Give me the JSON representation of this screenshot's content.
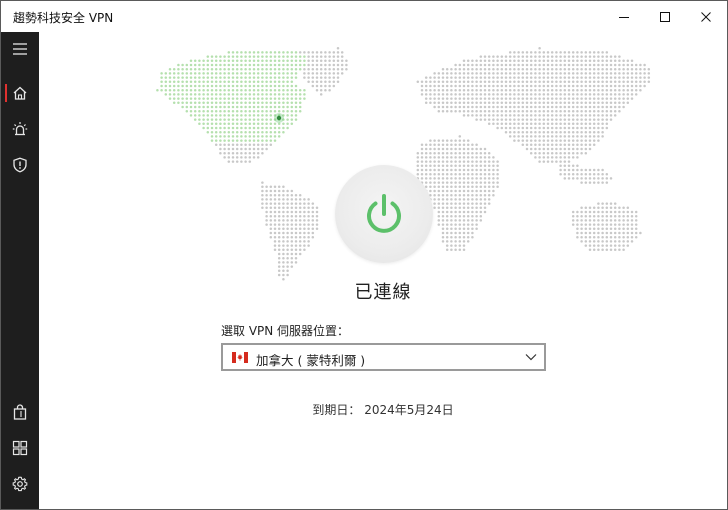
{
  "window": {
    "title": "趨勢科技安全 VPN"
  },
  "sidebar": {
    "items": [
      {
        "id": "menu",
        "icon": "hamburger-menu-icon"
      },
      {
        "id": "home",
        "icon": "home-icon",
        "active": true
      },
      {
        "id": "alerts",
        "icon": "siren-icon"
      },
      {
        "id": "security",
        "icon": "shield-icon"
      },
      {
        "id": "store",
        "icon": "shopping-bag-icon"
      },
      {
        "id": "apps",
        "icon": "grid-icon"
      },
      {
        "id": "settings",
        "icon": "gear-icon"
      }
    ],
    "active_color": "#e0312f",
    "background": "#1e1e1e"
  },
  "main": {
    "status": "已連線",
    "status_color": "#5cc06a",
    "server_label": "選取 VPN 伺服器位置：",
    "server_selected": "加拿大 ( 蒙特利爾 )",
    "server_flag": "canada-flag-icon",
    "expiry_label": "到期日：",
    "expiry_date": "2024年5月24日"
  }
}
